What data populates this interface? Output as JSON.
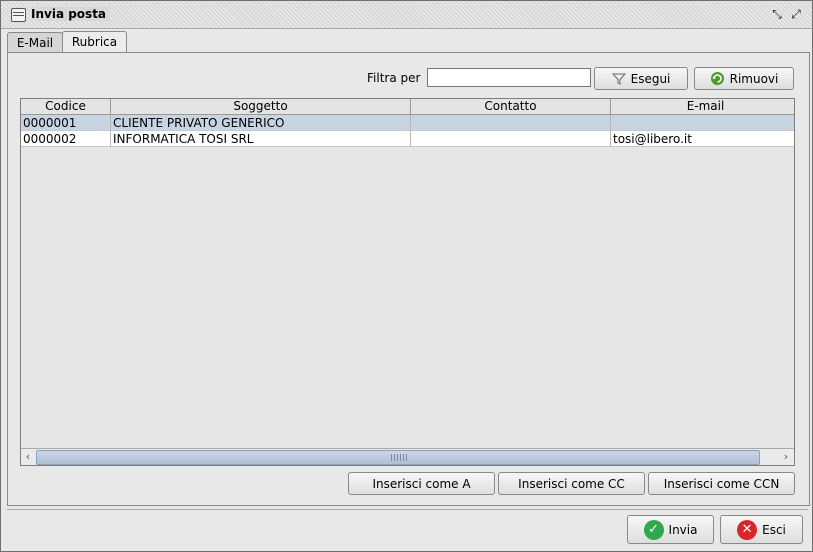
{
  "window": {
    "title": "Invia posta"
  },
  "tabs": [
    {
      "label": "E-Mail",
      "active": false
    },
    {
      "label": "Rubrica",
      "active": true
    }
  ],
  "filter": {
    "label": "Filtra per",
    "value": "",
    "apply_label": "Esegui",
    "remove_label": "Rimuovi"
  },
  "table": {
    "columns": [
      "Codice",
      "Soggetto",
      "Contatto",
      "E-mail"
    ],
    "rows": [
      {
        "codice": "0000001",
        "soggetto": "CLIENTE PRIVATO GENERICO",
        "contatto": "",
        "email": ""
      },
      {
        "codice": "0000002",
        "soggetto": "INFORMATICA TOSI SRL",
        "contatto": "",
        "email": "tosi@libero.it"
      }
    ]
  },
  "actions": {
    "insert_a": "Inserisci come A",
    "insert_cc": "Inserisci come CC",
    "insert_ccn": "Inserisci come CCN"
  },
  "footer": {
    "send_label": "Invia",
    "exit_label": "Esci"
  },
  "colors": {
    "selected_row": "#c9d4e2",
    "send_icon": "#2fa84f",
    "exit_icon": "#d9262b"
  }
}
